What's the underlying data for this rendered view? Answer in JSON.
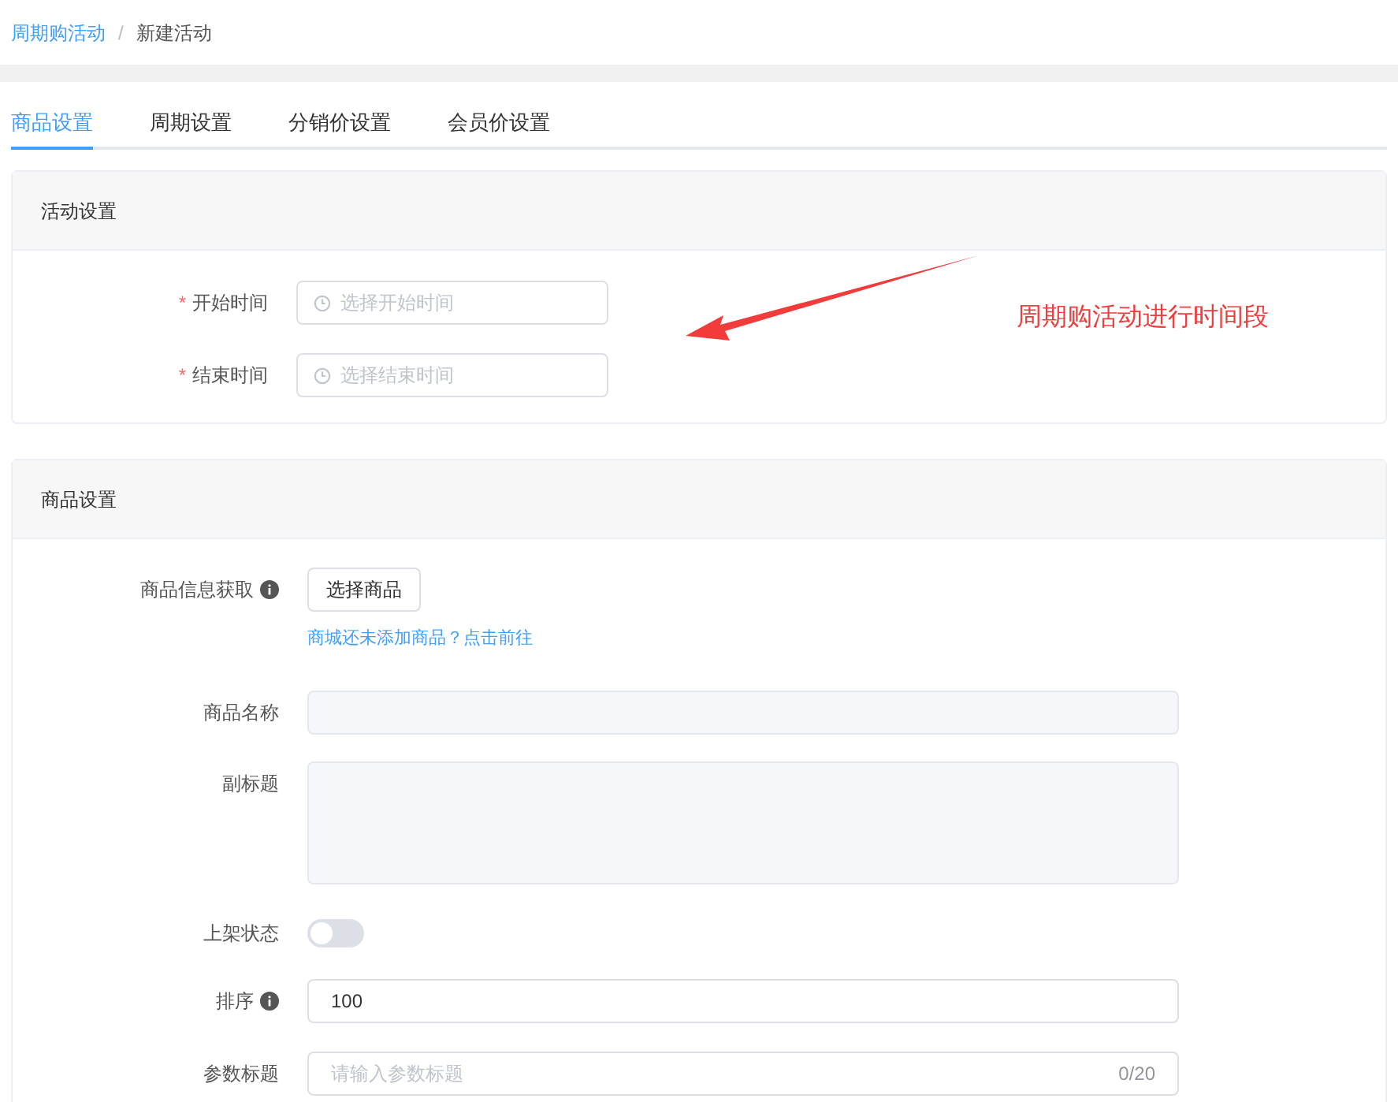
{
  "breadcrumb": [
    {
      "label": "周期购活动",
      "kind": "link"
    },
    {
      "label": "新建活动",
      "kind": "current"
    }
  ],
  "breadcrumb_separator": "/",
  "tabs": [
    {
      "label": "商品设置",
      "selected": true
    },
    {
      "label": "周期设置",
      "selected": false
    },
    {
      "label": "分销价设置",
      "selected": false
    },
    {
      "label": "会员价设置",
      "selected": false
    }
  ],
  "activity_section": {
    "title": "活动设置",
    "fields": [
      {
        "label": "开始时间",
        "required_mark": "*",
        "placeholder": "选择开始时间"
      },
      {
        "label": "结束时间",
        "required_mark": "*",
        "placeholder": "选择结束时间"
      }
    ]
  },
  "annotation": {
    "text": "周期购活动进行时间段"
  },
  "product_section": {
    "title": "商品设置",
    "rows": [
      {
        "kind": "picker",
        "label": "商品信息获取",
        "info": true,
        "button": "选择商品",
        "hint": "商城还未添加商品？点击前往"
      },
      {
        "kind": "disabled_input",
        "label": "商品名称",
        "info": false
      },
      {
        "kind": "textarea",
        "label": "副标题",
        "info": false
      },
      {
        "kind": "switch",
        "label": "上架状态",
        "info": false,
        "on": false
      },
      {
        "kind": "input",
        "label": "排序",
        "info": true,
        "value": "100"
      },
      {
        "kind": "input",
        "label": "参数标题",
        "info": false,
        "placeholder": "请输入参数标题",
        "counter": "0/20"
      }
    ]
  }
}
